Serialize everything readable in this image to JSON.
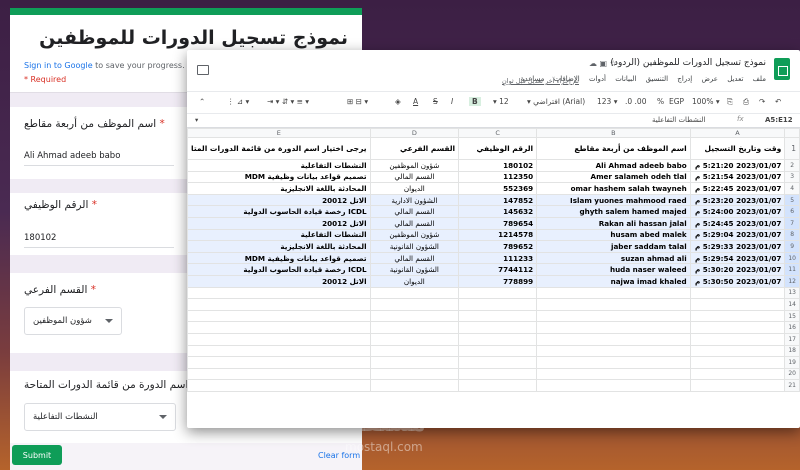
{
  "form": {
    "title": "نموذج تسجيل الدورات للموظفين",
    "signin_prefix": "Sign in to Google",
    "signin_rest": " to save your progress. Learn",
    "required": "* Required",
    "q1": {
      "label": "اسم الموظف من أربعة مقاطع",
      "value": "Ali Ahmad adeeb babo"
    },
    "q2": {
      "label": "الرقم الوظيفي",
      "value": "180102"
    },
    "q3": {
      "label": "القسم الفرعي",
      "value": "شؤون الموظفين"
    },
    "q4": {
      "label": "اختيار اسم الدورة من قائمة الدورات المتاحة",
      "value": "النشطات التفاعلية"
    },
    "submit": "Submit",
    "clear": "Clear form",
    "accent": "#0f9d58"
  },
  "sheet": {
    "title": "نموذج تسجيل الدورات للموظفين (الردود)",
    "menus": [
      "ملف",
      "تعديل",
      "عرض",
      "إدراج",
      "التنسيق",
      "البيانات",
      "أدوات",
      "الإضافات",
      "مساعدة"
    ],
    "last_edit": "تم إجراء آخر تعديل قبل ثوانٍ",
    "zoom": "100%",
    "currency": "EGP",
    "percent": "%",
    "dec1": ".0",
    "dec2": ".00",
    "numfmt": "123",
    "font": "افتراضي (Arial)",
    "fontsize": "12",
    "cell_ref": "A5:E12",
    "formula": "النشطات التفاعلية",
    "col_letters": [
      "A",
      "B",
      "C",
      "D",
      "E"
    ],
    "headers": [
      "وقت وتاريخ التسجيل",
      "اسم الموظف من أربعة مقاطع",
      "الرقم الوظيفي",
      "القسم الفرعي",
      "يرجى اختيار اسم الدورة من قائمة الدورات المتا"
    ],
    "rows": [
      [
        "2023/01/07 5:21:20 م",
        "Ali Ahmad adeeb babo",
        "180102",
        "شؤون الموظفين",
        "النشطات التفاعلية"
      ],
      [
        "2023/01/07 5:21:54 م",
        "Amer salameh odeh tlal",
        "112350",
        "القسم المالي",
        "تصميم قواعد بيانات وظيفية MDM"
      ],
      [
        "2023/01/07 5:22:45 م",
        "omar hashem  salah twayneh",
        "552369",
        "الديوان",
        "المحادثة باللغة الانجليزية"
      ],
      [
        "2023/01/07 5:23:20 م",
        "Islam yuones mahmood raed",
        "147852",
        "الشؤون الادارية",
        "الاتل 20012"
      ],
      [
        "2023/01/07 5:24:00 م",
        "ghyth salem hamed majed",
        "145632",
        "القسم المالي",
        "ICDL رخصة قيادة الحاسوب الدولية"
      ],
      [
        "2023/01/07 5:24:45 م",
        "Rakan ali hassan  jalal",
        "789654",
        "القسم المالي",
        "الاتل 20012"
      ],
      [
        "2023/01/07 5:29:04 م",
        "husam abed malek",
        "1214578",
        "شؤون الموظفين",
        "النشطات التفاعلية"
      ],
      [
        "2023/01/07 5:29:33 م",
        "jaber saddam talal",
        "789652",
        "الشؤون القانونية",
        "المحادثة باللغة الانجليزية"
      ],
      [
        "2023/01/07 5:29:54 م",
        "suzan ahmad ali",
        "111233",
        "القسم المالي",
        "تصميم قواعد بيانات وظيفية MDM"
      ],
      [
        "2023/01/07 5:30:20 م",
        "huda naser waleed",
        "7744112",
        "الشؤون القانونية",
        "ICDL رخصة قيادة الحاسوب الدولية"
      ],
      [
        "2023/01/07 5:30:50 م",
        "najwa imad khaled",
        "778899",
        "الديوان",
        "الاتل 20012"
      ]
    ],
    "row_numbers": [
      "1",
      "2",
      "3",
      "4",
      "5",
      "6",
      "7",
      "8",
      "9",
      "10",
      "11",
      "12",
      "13",
      "14",
      "15",
      "16",
      "17",
      "18",
      "19",
      "20",
      "21"
    ]
  },
  "watermark": {
    "text": "مستقل",
    "sub": "mostaql.com"
  }
}
